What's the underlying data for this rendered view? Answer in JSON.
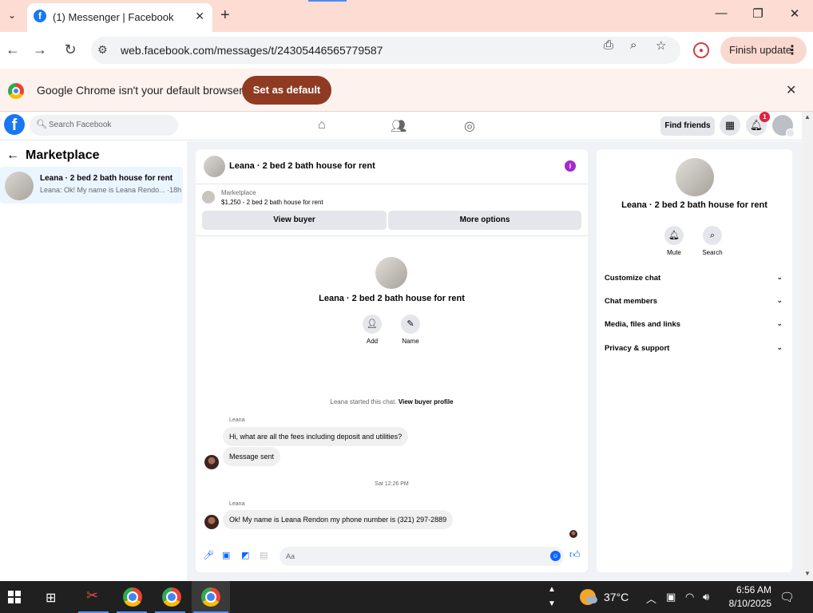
{
  "browser": {
    "tab_title": "(1) Messenger | Facebook",
    "url": "web.facebook.com/messages/t/24305446565779587",
    "finish_update_label": "Finish update",
    "infobar_text": "Google Chrome isn't your default browser",
    "set_default_label": "Set as default"
  },
  "fb_header": {
    "search_placeholder": "Search Facebook",
    "find_friends_label": "Find friends",
    "notification_count": "1"
  },
  "left": {
    "title": "Marketplace",
    "conversation": {
      "name": "Leana · 2 bed 2 bath house for rent",
      "preview": "Leana: Ok! My name is Leana Rendo... ·18h"
    }
  },
  "chat": {
    "title": "Leana · 2 bed 2 bath house for rent",
    "listing_label": "Marketplace",
    "listing_title": "$1,250 - 2 bed 2 bath house for rent",
    "view_buyer_label": "View buyer",
    "more_options_label": "More options",
    "profile_name": "Leana · 2 bed 2 bath house for rent",
    "add_label": "Add",
    "name_label": "Name",
    "system_text": "Leana started this chat.",
    "system_link": "View buyer profile",
    "messages": [
      {
        "sender": "Leana",
        "text": "Hi, what are all the fees including deposit and utilities?"
      },
      {
        "text": "Message sent"
      },
      {
        "sender": "Leana",
        "text": "Ok! My name is Leana Rendon my phone number is (321) 297-2889"
      }
    ],
    "timestamp": "Sat 12:26 PM",
    "composer_placeholder": "Aa"
  },
  "details": {
    "name": "Leana · 2 bed 2 bath house for rent",
    "mute_label": "Mute",
    "search_label": "Search",
    "sections": [
      "Customize chat",
      "Chat members",
      "Media, files and links",
      "Privacy & support"
    ]
  },
  "taskbar": {
    "temperature": "37°C",
    "time": "6:56 AM",
    "date": "8/10/2025"
  },
  "colors": {
    "fb_blue": "#1877f2",
    "messenger_blue": "#0866ff",
    "info_purple": "#a12ad0",
    "set_default_button": "#8f3b23",
    "tab_strip": "#fcdcd3"
  }
}
